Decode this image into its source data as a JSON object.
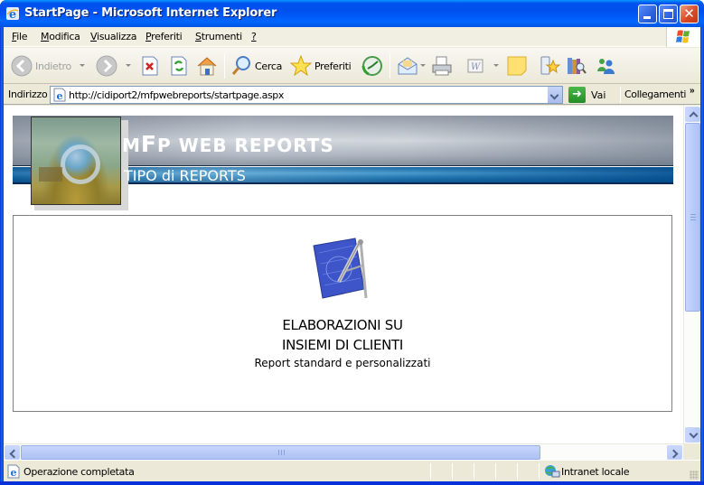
{
  "window": {
    "title": "StartPage - Microsoft Internet Explorer",
    "controls": {
      "minimize": "minimize",
      "maximize": "maximize",
      "close": "close"
    }
  },
  "menubar": {
    "items": [
      {
        "label": "File",
        "accel": "F"
      },
      {
        "label": "Modifica",
        "accel": "M"
      },
      {
        "label": "Visualizza",
        "accel": "V"
      },
      {
        "label": "Preferiti",
        "accel": "P"
      },
      {
        "label": "Strumenti",
        "accel": "S"
      },
      {
        "label": "?",
        "accel": "?"
      }
    ]
  },
  "toolbar": {
    "back_label": "Indietro",
    "search_label": "Cerca",
    "favorites_label": "Preferiti",
    "buttons": [
      "back",
      "forward",
      "stop",
      "refresh",
      "home",
      "search",
      "favorites",
      "history",
      "mail",
      "print",
      "edit-word",
      "discuss",
      "messenger-note",
      "research",
      "messenger"
    ]
  },
  "addressbar": {
    "label": "Indirizzo",
    "url": "http://cidiport2/mfpwebreports/startpage.aspx",
    "go_label": "Vai",
    "links_label": "Collegamenti",
    "more": "»"
  },
  "page": {
    "banner": {
      "title_m": "M",
      "title_f": "F",
      "title_rest": "P WEB REPORTS",
      "subtitle": "TIPO di REPORTS"
    },
    "panel": {
      "title_line1": "ELABORAZIONI SU",
      "title_line2": "INSIEMI DI CLIENTI",
      "subtitle": "Report standard e personalizzati"
    }
  },
  "statusbar": {
    "text": "Operazione completata",
    "zone": "Intranet locale"
  },
  "colors": {
    "titlebar": "#0053ee",
    "banner_blue": "#1a6fa8",
    "banner_grey": "#b7bdc6",
    "chrome": "#ece9d8"
  }
}
